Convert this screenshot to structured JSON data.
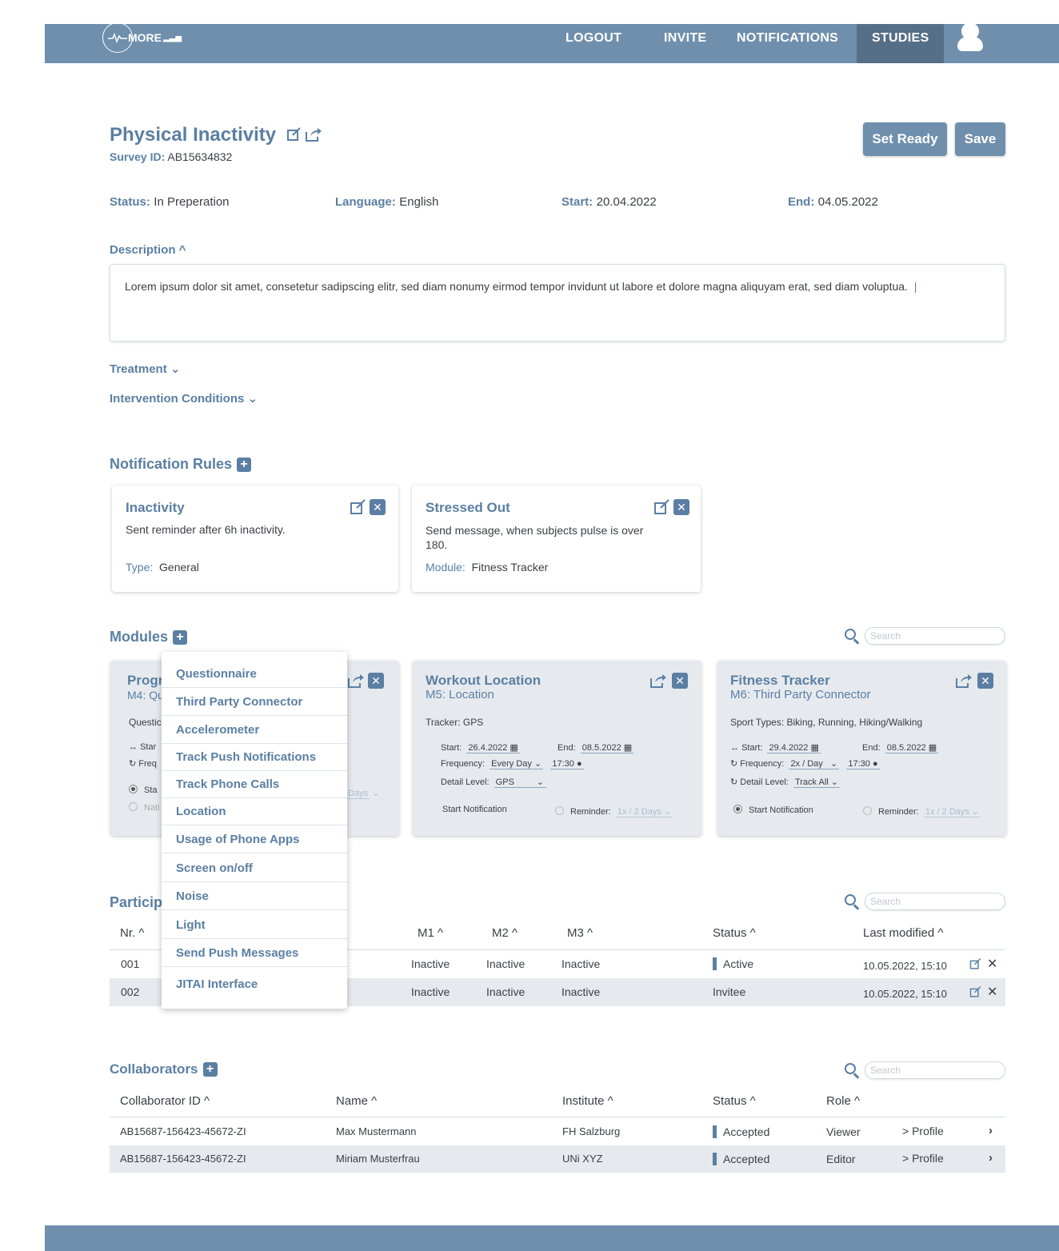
{
  "nav": {
    "logo": "MORE",
    "links": [
      "LOGOUT",
      "INVITE",
      "NOTIFICATIONS",
      "STUDIES"
    ]
  },
  "study": {
    "title": "Physical Inactivity",
    "survey_id_label": "Survey ID:",
    "survey_id": "AB15634832",
    "set_ready": "Set Ready",
    "save": "Save",
    "status_label": "Status:",
    "status": "In Preperation",
    "language_label": "Language:",
    "language": "English",
    "start_label": "Start:",
    "start": "20.04.2022",
    "end_label": "End:",
    "end": "04.05.2022",
    "description_label": "Description ^",
    "description": "Lorem ipsum dolor sit amet, consetetur sadipscing elitr, sed diam nonumy eirmod tempor invidunt ut labore et dolore magna aliquyam erat, sed diam voluptua.",
    "treatment_label": "Treatment ⌄",
    "intervention_label": "Intervention Conditions ⌄"
  },
  "notification_rules": {
    "heading": "Notification Rules",
    "cards": [
      {
        "title": "Inactivity",
        "text": "Sent reminder after 6h inactivity.",
        "meta_label": "Type:",
        "meta_value": "General"
      },
      {
        "title": "Stressed Out",
        "text": "Send message, when subjects pulse is over 180.",
        "meta_label": "Module:",
        "meta_value": "Fitness Tracker"
      }
    ]
  },
  "modules": {
    "heading": "Modules",
    "search_placeholder": "Search",
    "card1": {
      "title_partial": "Progr",
      "sub_partial": "M4: Qu",
      "line1": "Questic",
      "l2": "Star",
      "l3": "Freq",
      "l4": "Sta",
      "l5": "Nati",
      "days": "Days"
    },
    "card2": {
      "title": "Workout Location",
      "subtitle": "M5: Location",
      "tracker": "Tracker: GPS",
      "start_label": "Start:",
      "start": "26.4.2022",
      "end_label": "End:",
      "end": "08.5.2022",
      "freq_label": "Frequency:",
      "freq": "Every Day",
      "time": "17:30",
      "detail_label": "Detail Level:",
      "detail": "GPS",
      "start_notification": "Start Notification",
      "reminder_label": "Reminder:",
      "reminder": "1x / 2 Days"
    },
    "card3": {
      "title": "Fitness Tracker",
      "subtitle": "M6: Third Party Connector",
      "sport": "Sport Types: Biking, Running, Hiking/Walking",
      "start_label": "Start:",
      "start": "29.4.2022",
      "end_label": "End:",
      "end": "08.5.2022",
      "freq_label": "Frequency:",
      "freq": "2x / Day",
      "time": "17:30",
      "detail_label": "Detail Level:",
      "detail": "Track All",
      "start_notification": "Start Notification",
      "reminder_label": "Reminder:",
      "reminder": "1x / 2 Days"
    },
    "dropdown": [
      "Questionnaire",
      "Third Party Connector",
      "Accelerometer",
      "Track Push Notifications",
      "Track Phone Calls",
      "Location",
      "Usage of Phone Apps",
      "Screen on/off",
      "Noise",
      "Light",
      "Send Push Messages",
      "JITAI Interface"
    ]
  },
  "participants": {
    "heading_partial": "Particip",
    "search_placeholder": "Search",
    "headers": {
      "nr": "Nr. ^",
      "m1": "M1 ^",
      "m2": "M2 ^",
      "m3": "M3 ^",
      "status": "Status ^",
      "modified": "Last modified ^"
    },
    "rows": [
      {
        "nr": "001",
        "m1": "Inactive",
        "m2": "Inactive",
        "m3": "Inactive",
        "status": "Active",
        "modified": "10.05.2022, 15:10"
      },
      {
        "nr": "002",
        "m1": "Inactive",
        "m2": "Inactive",
        "m3": "Inactive",
        "status": "Invitee",
        "modified": "10.05.2022, 15:10"
      }
    ]
  },
  "collaborators": {
    "heading": "Collaborators",
    "search_placeholder": "Search",
    "headers": {
      "id": "Collaborator ID ^",
      "name": "Name ^",
      "institute": "Institute ^",
      "status": "Status ^",
      "role": "Role ^"
    },
    "rows": [
      {
        "id": "AB15687-156423-45672-ZI",
        "name": "Max Mustermann",
        "institute": "FH Salzburg",
        "status": "Accepted",
        "role": "Viewer",
        "profile": "Profile"
      },
      {
        "id": "AB15687-156423-45672-ZI",
        "name": "Miriam Musterfrau",
        "institute": "UNi XYZ",
        "status": "Accepted",
        "role": "Editor",
        "profile": "Profile"
      }
    ]
  },
  "colors": {
    "accent": "#5b7fa3",
    "navbar": "#6f8fad",
    "active_tab": "#566f88",
    "card_grey": "#e6eaee"
  }
}
